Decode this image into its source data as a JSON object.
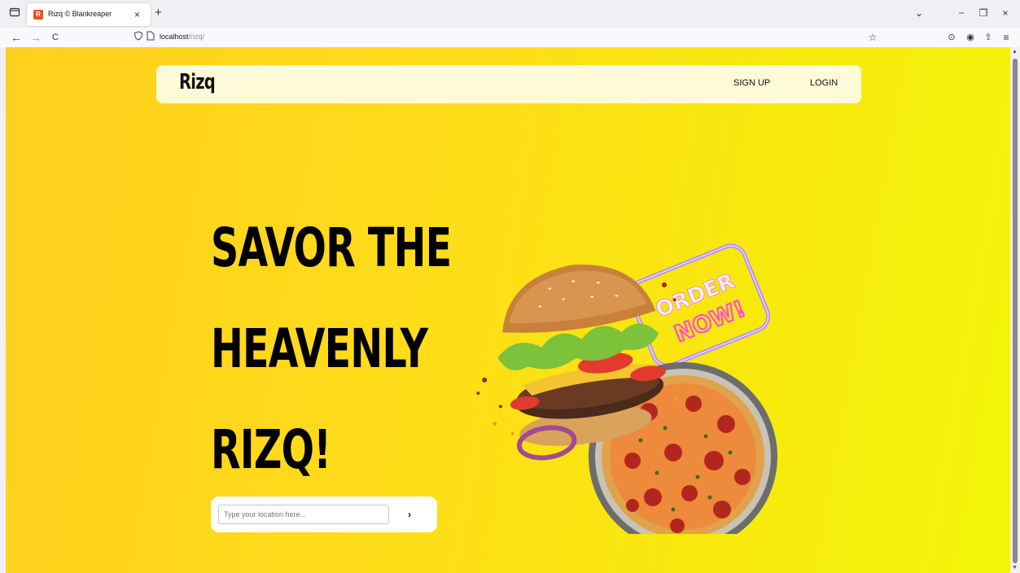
{
  "browser": {
    "tab": {
      "favicon_label": "R",
      "title": "Rizq © Blankreaper",
      "close_glyph": "×"
    },
    "new_tab_glyph": "+",
    "list_all_tabs_glyph": "⌄",
    "window": {
      "minimize": "−",
      "restore": "❐",
      "close": "×"
    },
    "nav": {
      "back": "←",
      "forward": "→",
      "reload": "C"
    },
    "url": {
      "host": "localhost",
      "path": "/rizq/"
    },
    "bookmark_glyph": "☆",
    "toolbar": {
      "pocket": "⊙",
      "account": "◉",
      "extensions": "⇪",
      "menu": "≡"
    }
  },
  "site": {
    "logo": "Rizq",
    "nav": {
      "signup": "SIGN UP",
      "login": "LOGIN"
    },
    "hero": {
      "line1": "SAVOR THE",
      "line2": "HEAVENLY",
      "line3": "RIZQ!"
    },
    "search": {
      "placeholder": "Type your location here...",
      "submit": "›"
    },
    "neon_sign": {
      "top": "ORDER",
      "bottom": "NOW!"
    }
  },
  "colors": {
    "background_start": "#ffcf1e",
    "background_end": "#f4f50a",
    "header_bg": "#fffbd9",
    "neon_purple": "#b48cff",
    "neon_pink": "#ff4fd8"
  }
}
